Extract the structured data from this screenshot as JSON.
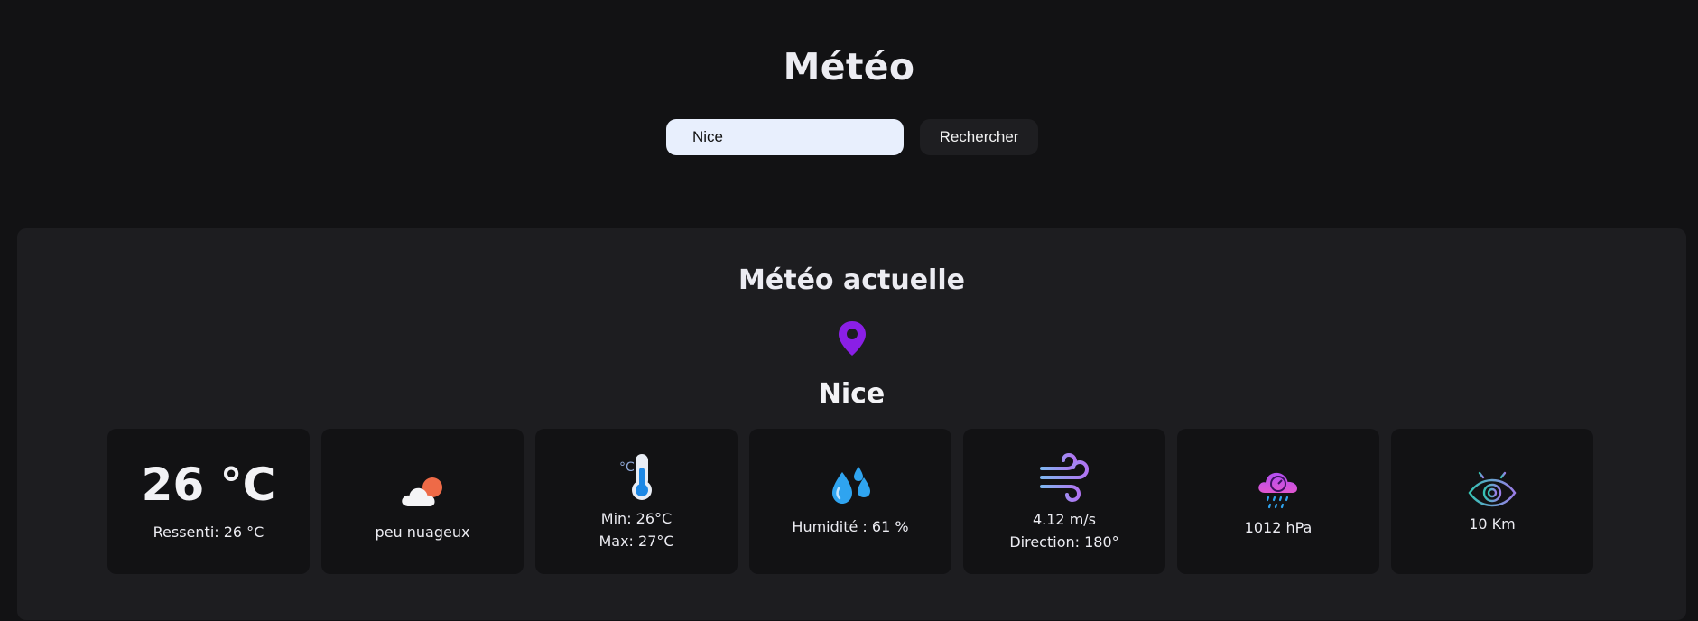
{
  "header": {
    "title": "Météo"
  },
  "search": {
    "value": "Nice",
    "button_label": "Rechercher"
  },
  "current": {
    "section_title": "Météo actuelle",
    "city": "Nice",
    "temperature": "26 °C",
    "feels_like": "Ressenti: 26 °C",
    "description": "peu nuageux",
    "min": "Min: 26°C",
    "max": "Max: 27°C",
    "humidity": "Humidité : 61 %",
    "wind_speed": "4.12 m/s",
    "wind_direction": "Direction: 180°",
    "pressure": "1012 hPa",
    "visibility": "10 Km"
  },
  "icons": {
    "location": "location-pin-icon",
    "weather": "partly-cloudy-icon",
    "thermometer": "thermometer-icon",
    "humidity": "water-drops-icon",
    "wind": "wind-icon",
    "pressure": "pressure-cloud-icon",
    "visibility": "eye-icon"
  },
  "colors": {
    "background": "#121214",
    "panel": "#1d1d20",
    "card": "#121214",
    "accent_purple": "#8a1fe6",
    "input_bg": "#e8effd"
  }
}
